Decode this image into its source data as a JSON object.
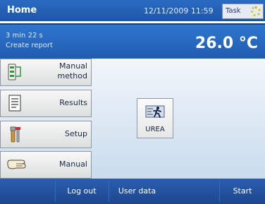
{
  "header": {
    "title": "Home",
    "datetime": "12/11/2009 11:59",
    "task_label": "Task"
  },
  "status": {
    "elapsed": "3 min 22 s",
    "task": "Create report",
    "temperature": "26.0 °C"
  },
  "sidebar": {
    "items": [
      {
        "label_line1": "Manual",
        "label_line2": "method",
        "icon": "method-list-icon"
      },
      {
        "label": "Results",
        "icon": "clipboard-icon"
      },
      {
        "label": "Setup",
        "icon": "tools-icon"
      },
      {
        "label": "Manual",
        "icon": "hand-icon"
      }
    ]
  },
  "main": {
    "method": {
      "label": "UREA",
      "icon": "running-man-icon"
    }
  },
  "footer": {
    "buttons": [
      {
        "label": "Log out"
      },
      {
        "label": "User data"
      },
      {
        "label": "Start"
      }
    ]
  },
  "colors": {
    "header_blue": "#1e56a7",
    "footer_blue": "#1c458e",
    "main_bg": "#c9dced"
  }
}
